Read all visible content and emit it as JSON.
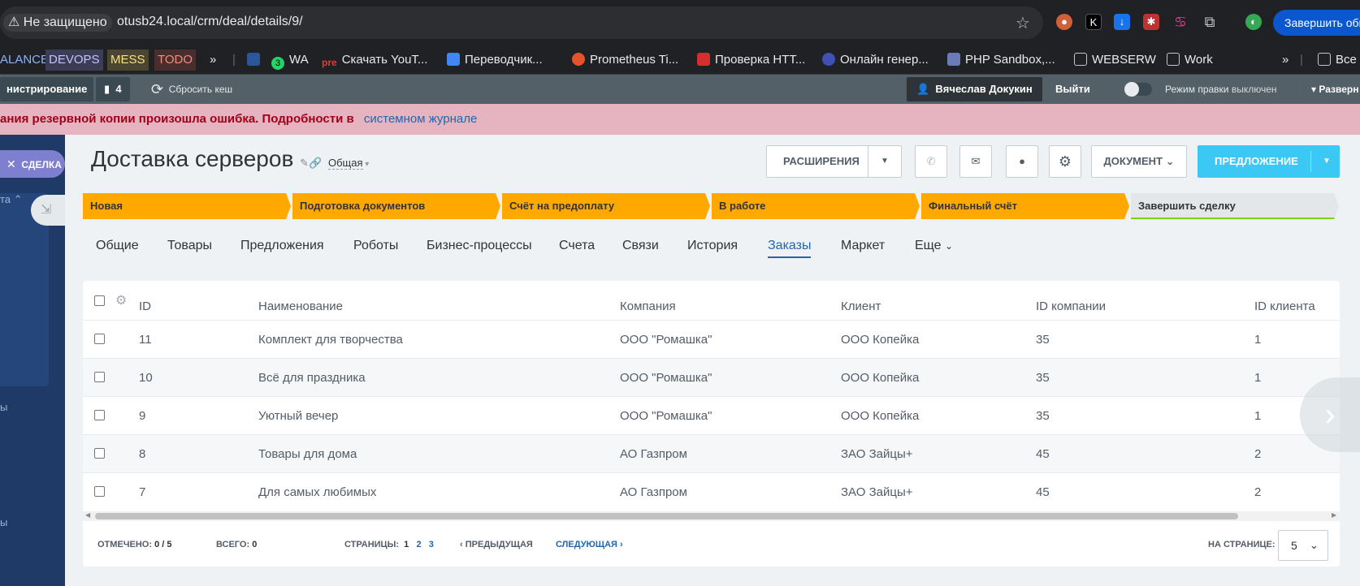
{
  "browser": {
    "security": "Не защищено",
    "url": "otusb24.local/crm/deal/details/9/",
    "finish_button": "Завершить обн",
    "bookmarks": [
      "ALANCE",
      "DEVOPS",
      "MESS",
      "TODO",
      "»",
      "WA",
      "Скачать YouT...",
      "Переводчик...",
      "Prometheus Ti...",
      "Проверка HTT...",
      "Онлайн генер...",
      "PHP Sandbox,...",
      "WEBSERW",
      "Work",
      "»",
      "Все"
    ],
    "wa_badge": "3"
  },
  "admin_panel": {
    "admin_label": "нистрирование",
    "counter": "4",
    "reset_cache": "Сбросить кеш",
    "user": "Вячеслав Докукин",
    "logout": "Выйти",
    "edit_mode_label": "Режим правки",
    "edit_mode_state": "выключен",
    "expand": "Разверн"
  },
  "backup_error": {
    "text": "ания резервной копии произошла ошибка. Подробности в",
    "link": "системном журнале"
  },
  "leftnav": {
    "deal_tab": "СДЕЛКА",
    "item1": "та",
    "item2": "ы",
    "item3": "ы"
  },
  "deal": {
    "title": "Доставка серверов",
    "category": "Общая",
    "extensions_button": "РАСШИРЕНИЯ",
    "document_button": "ДОКУМЕНТ",
    "offer_button": "ПРЕДЛОЖЕНИЕ",
    "stages": [
      "Новая",
      "Подготовка документов",
      "Счёт на предоплату",
      "В работе",
      "Финальный счёт",
      "Завершить сделку"
    ],
    "stage_colors": [
      "#ffa900",
      "#ffa900",
      "#ffa900",
      "#ffa900",
      "#ffa900",
      "#e4e7ea"
    ],
    "tabs": [
      "Общие",
      "Товары",
      "Предложения",
      "Роботы",
      "Бизнес-процессы",
      "Счета",
      "Связи",
      "История",
      "Заказы",
      "Маркет",
      "Еще"
    ],
    "active_tab": "Заказы"
  },
  "grid": {
    "columns": [
      "ID",
      "Наименование",
      "Компания",
      "Клиент",
      "ID компании",
      "ID клиента"
    ],
    "rows": [
      {
        "id": "11",
        "name": "Комплект для творчества",
        "company": "ООО \"Ромашка\"",
        "client": "ООО Копейка",
        "company_id": "35",
        "client_id": "1"
      },
      {
        "id": "10",
        "name": "Всё для праздника",
        "company": "ООО \"Ромашка\"",
        "client": "ООО Копейка",
        "company_id": "35",
        "client_id": "1"
      },
      {
        "id": "9",
        "name": "Уютный вечер",
        "company": "ООО \"Ромашка\"",
        "client": "ООО Копейка",
        "company_id": "35",
        "client_id": "1"
      },
      {
        "id": "8",
        "name": "Товары для дома",
        "company": "АО Газпром",
        "client": "ЗАО Зайцы+",
        "company_id": "45",
        "client_id": "2"
      },
      {
        "id": "7",
        "name": "Для самых любимых",
        "company": "АО Газпром",
        "client": "ЗАО Зайцы+",
        "company_id": "45",
        "client_id": "2"
      }
    ],
    "footer": {
      "selected_label": "ОТМЕЧЕНО:",
      "selected_value": "0 / 5",
      "total_label": "ВСЕГО:",
      "total_value": "0",
      "pages_label": "СТРАНИЦЫ:",
      "pages": [
        "1",
        "2",
        "3"
      ],
      "prev": "ПРЕДЫДУЩАЯ",
      "next": "СЛЕДУЮЩАЯ",
      "per_page_label": "НА СТРАНИЦЕ:",
      "per_page_value": "5"
    }
  },
  "colors": {
    "accent": "#2066b0",
    "offer": "#3bc8f5",
    "stage": "#ffa900",
    "leftnav": "#1f3a66"
  }
}
